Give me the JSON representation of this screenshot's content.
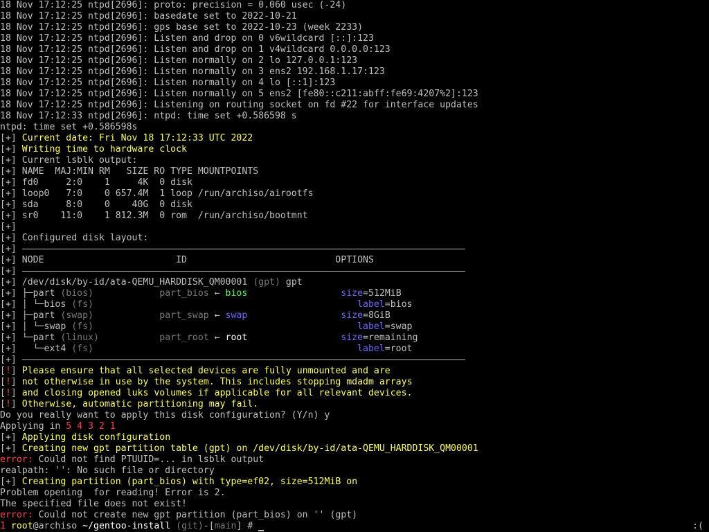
{
  "terminal": {
    "lines": [
      [
        [
          "w",
          "18 Nov 17:12:25 ntpd[2696]: proto: precision = 0.060 usec (-24)"
        ]
      ],
      [
        [
          "w",
          "18 Nov 17:12:25 ntpd[2696]: basedate set to 2022-10-21"
        ]
      ],
      [
        [
          "w",
          "18 Nov 17:12:25 ntpd[2696]: gps base set to 2022-10-23 (week 2233)"
        ]
      ],
      [
        [
          "w",
          "18 Nov 17:12:25 ntpd[2696]: Listen and drop on 0 v6wildcard [::]:123"
        ]
      ],
      [
        [
          "w",
          "18 Nov 17:12:25 ntpd[2696]: Listen and drop on 1 v4wildcard 0.0.0.0:123"
        ]
      ],
      [
        [
          "w",
          "18 Nov 17:12:25 ntpd[2696]: Listen normally on 2 lo 127.0.0.1:123"
        ]
      ],
      [
        [
          "w",
          "18 Nov 17:12:25 ntpd[2696]: Listen normally on 3 ens2 192.168.1.17:123"
        ]
      ],
      [
        [
          "w",
          "18 Nov 17:12:25 ntpd[2696]: Listen normally on 4 lo [::1]:123"
        ]
      ],
      [
        [
          "w",
          "18 Nov 17:12:25 ntpd[2696]: Listen normally on 5 ens2 [fe80::c211:abff:fe69:4207%2]:123"
        ]
      ],
      [
        [
          "w",
          "18 Nov 17:12:25 ntpd[2696]: Listening on routing socket on fd #22 for interface updates"
        ]
      ],
      [
        [
          "w",
          "18 Nov 17:12:33 ntpd[2696]: ntpd: time set +0.586598 s"
        ]
      ],
      [
        [
          "w",
          "ntpd: time set +0.586598s"
        ]
      ],
      [
        [
          "w",
          "[+] "
        ],
        [
          "y",
          "Current date: Fri Nov 18 17:12:33 UTC 2022"
        ]
      ],
      [
        [
          "w",
          "[+] "
        ],
        [
          "y",
          "Writing time to hardware clock"
        ]
      ],
      [
        [
          "w",
          "[+] Current lsblk output:"
        ]
      ],
      [
        [
          "w",
          "[+] NAME  MAJ:MIN RM   SIZE RO TYPE MOUNTPOINTS"
        ]
      ],
      [
        [
          "w",
          "[+] fd0     2:0    1     4K  0 disk"
        ]
      ],
      [
        [
          "w",
          "[+] loop0   7:0    0 657.4M  1 loop /run/archiso/airootfs"
        ]
      ],
      [
        [
          "w",
          "[+] sda     8:0    0    40G  0 disk"
        ]
      ],
      [
        [
          "w",
          "[+] sr0    11:0    1 812.3M  0 rom  /run/archiso/bootmnt"
        ]
      ],
      [
        [
          "w",
          "[+]"
        ]
      ],
      [
        [
          "w",
          "[+] Configured disk layout:"
        ]
      ],
      [
        [
          "w",
          "[+]"
        ],
        [
          "rule",
          ""
        ]
      ],
      [
        [
          "w",
          "[+] NODE                        ID                           OPTIONS"
        ]
      ],
      [
        [
          "w",
          "[+]"
        ],
        [
          "rule",
          ""
        ]
      ],
      [
        [
          "w",
          "[+] /dev/disk/by-id/ata-QEMU_HARDDISK_QM00001 "
        ],
        [
          "d",
          "(gpt)"
        ],
        [
          "w",
          " gpt"
        ]
      ],
      [
        [
          "w",
          "[+] ├─part "
        ],
        [
          "d",
          "(bios)            part_bios"
        ],
        [
          "w",
          " ← "
        ],
        [
          "g",
          "bios"
        ],
        [
          "w",
          "                 "
        ],
        [
          "b",
          "size"
        ],
        [
          "w",
          "=512MiB"
        ]
      ],
      [
        [
          "w",
          "[+] │ └─bios "
        ],
        [
          "d",
          "(fs)"
        ],
        [
          "w",
          "                                                "
        ],
        [
          "b",
          "label"
        ],
        [
          "w",
          "=bios"
        ]
      ],
      [
        [
          "w",
          "[+] ├─part "
        ],
        [
          "d",
          "(swap)            part_swap"
        ],
        [
          "w",
          " ← "
        ],
        [
          "b",
          "swap"
        ],
        [
          "w",
          "                 "
        ],
        [
          "b",
          "size"
        ],
        [
          "w",
          "=8GiB"
        ]
      ],
      [
        [
          "w",
          "[+] │ └─swap "
        ],
        [
          "d",
          "(fs)"
        ],
        [
          "w",
          "                                                "
        ],
        [
          "b",
          "label"
        ],
        [
          "w",
          "=swap"
        ]
      ],
      [
        [
          "w",
          "[+] └─part "
        ],
        [
          "d",
          "(linux)           part_root"
        ],
        [
          "w",
          " ← "
        ],
        [
          "W",
          "root"
        ],
        [
          "w",
          "                 "
        ],
        [
          "b",
          "size"
        ],
        [
          "w",
          "=remaining"
        ]
      ],
      [
        [
          "w",
          "[+]   └─ext4 "
        ],
        [
          "d",
          "(fs)"
        ],
        [
          "w",
          "                                                "
        ],
        [
          "b",
          "label"
        ],
        [
          "w",
          "=root"
        ]
      ],
      [
        [
          "w",
          "[+]"
        ],
        [
          "rule",
          ""
        ]
      ],
      [
        [
          "w",
          "["
        ],
        [
          "r",
          "!"
        ],
        [
          "w",
          "] "
        ],
        [
          "y",
          "Please ensure that all selected devices are fully unmounted and are"
        ]
      ],
      [
        [
          "w",
          "["
        ],
        [
          "r",
          "!"
        ],
        [
          "w",
          "] "
        ],
        [
          "y",
          "not otherwise in use by the system. This includes stopping mdadm arrays"
        ]
      ],
      [
        [
          "w",
          "["
        ],
        [
          "r",
          "!"
        ],
        [
          "w",
          "] "
        ],
        [
          "y",
          "and closing opened luks volumes if applicable for all relevant devices."
        ]
      ],
      [
        [
          "w",
          "["
        ],
        [
          "r",
          "!"
        ],
        [
          "w",
          "] "
        ],
        [
          "y",
          "Otherwise, automatic partitioning may fail."
        ]
      ],
      [
        [
          "w",
          "Do you really want to apply this disk configuration? (Y/n) y"
        ]
      ],
      [
        [
          "w",
          "Applying in "
        ],
        [
          "r",
          "5 4 3 2 1"
        ]
      ],
      [
        [
          "w",
          "[+] "
        ],
        [
          "y",
          "Applying disk configuration"
        ]
      ],
      [
        [
          "w",
          "[+] "
        ],
        [
          "y",
          "Creating new gpt partition table (gpt) on /dev/disk/by-id/ata-QEMU_HARDDISK_QM00001"
        ]
      ],
      [
        [
          "r",
          "error:"
        ],
        [
          "w",
          " Could not find PTUUID=... in lsblk output"
        ]
      ],
      [
        [
          "w",
          "realpath: '': No such file or directory"
        ]
      ],
      [
        [
          "w",
          "[+] "
        ],
        [
          "y",
          "Creating partition (part_bios) with type=ef02, size=512MiB on"
        ]
      ],
      [
        [
          "w",
          "Problem opening  for reading! Error is 2."
        ]
      ],
      [
        [
          "w",
          "The specified file does not exist!"
        ]
      ],
      [
        [
          "r",
          "error:"
        ],
        [
          "w",
          " Could not create new gpt partition (part_bios) on '' (gpt)"
        ]
      ],
      [
        [
          "r",
          "1 "
        ],
        [
          "y",
          "root"
        ],
        [
          "w",
          "@archiso "
        ],
        [
          "W",
          "~/gentoo-install"
        ],
        [
          "w",
          " "
        ],
        [
          "d",
          "(git)"
        ],
        [
          "w",
          "-["
        ],
        [
          "d",
          "main"
        ],
        [
          "w",
          "] # "
        ],
        [
          "cursor",
          ""
        ]
      ]
    ]
  },
  "status_right": ":(",
  "colors": {
    "default": "#c0c0c0",
    "yellow": "#ffff55",
    "red": "#ff4040",
    "green": "#55ff55",
    "blue": "#6a6aff",
    "dim": "#7a7a7a",
    "white": "#ffffff",
    "background": "#000000"
  }
}
